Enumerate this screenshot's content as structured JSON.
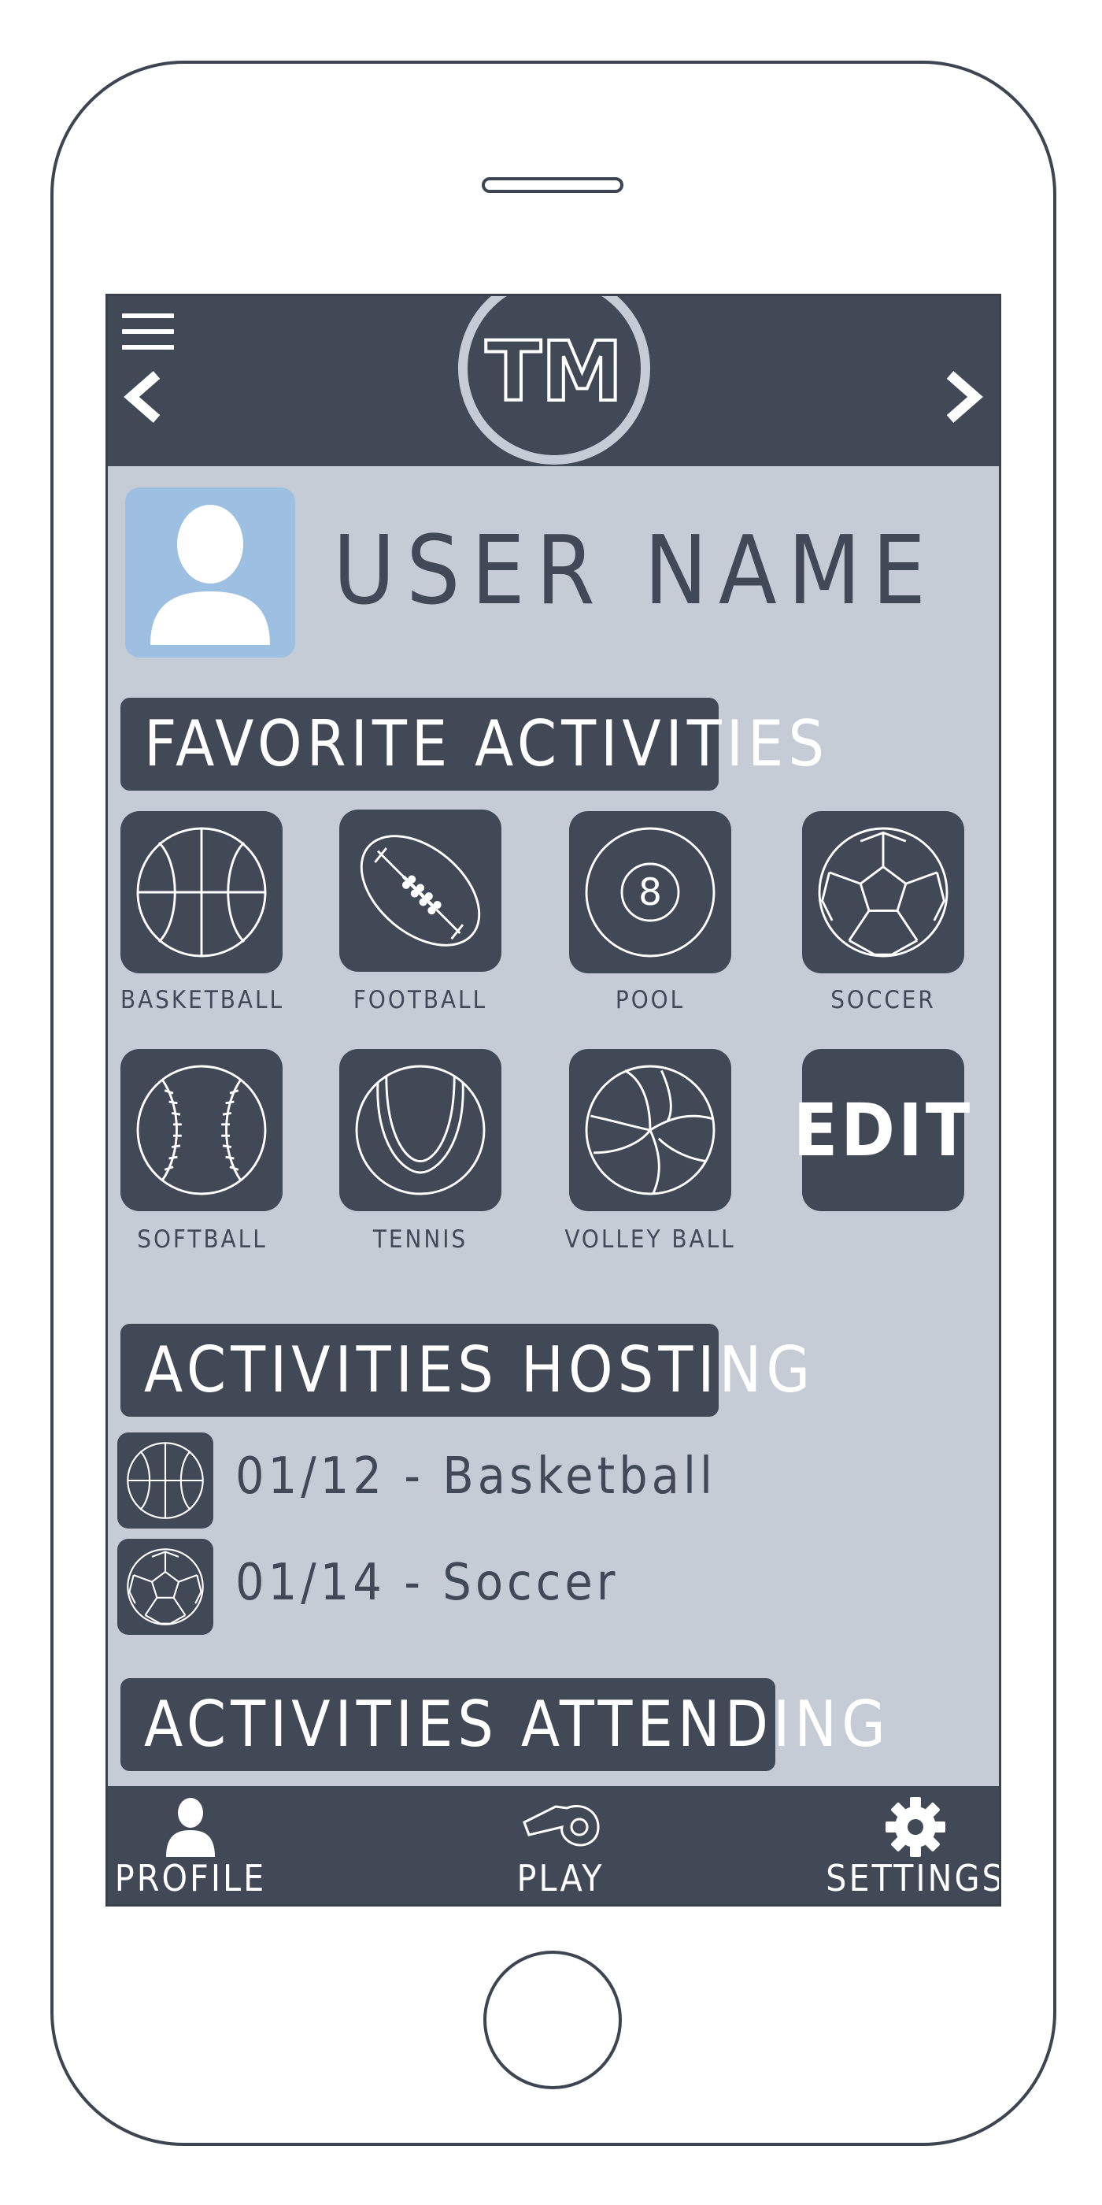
{
  "header": {
    "logo_text": "TM"
  },
  "profile": {
    "user_name": "USER NAME"
  },
  "favorites": {
    "title": "FAVORITE ACTIVITIES",
    "items": [
      {
        "label": "BASKETBALL",
        "icon": "basketball-icon"
      },
      {
        "label": "FOOTBALL",
        "icon": "football-icon"
      },
      {
        "label": "POOL",
        "icon": "pool-ball-icon"
      },
      {
        "label": "SOCCER",
        "icon": "soccer-ball-icon"
      },
      {
        "label": "SOFTBALL",
        "icon": "softball-icon"
      },
      {
        "label": "TENNIS",
        "icon": "tennis-ball-icon"
      },
      {
        "label": "VOLLEY BALL",
        "icon": "volleyball-icon"
      }
    ],
    "edit_label": "EDIT",
    "pool_number": "8"
  },
  "hosting": {
    "title": "ACTIVITIES HOSTING",
    "items": [
      {
        "text": "01/12 - Basketball",
        "icon": "basketball-icon"
      },
      {
        "text": "01/14 - Soccer",
        "icon": "soccer-ball-icon"
      }
    ]
  },
  "attending": {
    "title": "ACTIVITIES ATTENDING"
  },
  "bottom_nav": {
    "items": [
      {
        "label": "PROFILE",
        "icon": "person-icon"
      },
      {
        "label": "PLAY",
        "icon": "whistle-icon"
      },
      {
        "label": "SETTINGS",
        "icon": "gear-icon"
      }
    ]
  },
  "colors": {
    "dark": "#414956",
    "screen_bg": "#c6ccd6",
    "avatar_bg": "#9dc0e2",
    "white": "#ffffff"
  }
}
